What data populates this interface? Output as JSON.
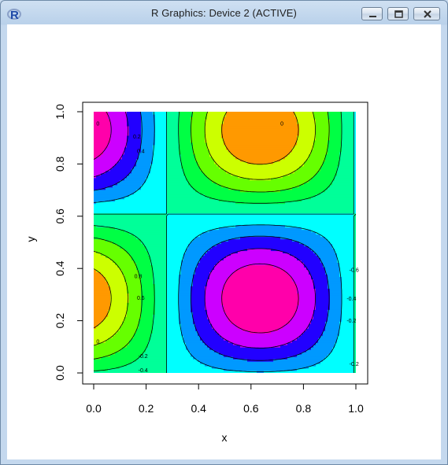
{
  "window": {
    "title": "R Graphics: Device 2 (ACTIVE)",
    "app_icon_letter": "R",
    "buttons": [
      "minimize",
      "maximize",
      "close"
    ]
  },
  "chart_data": {
    "type": "contour",
    "title": "",
    "xlabel": "x",
    "ylabel": "y",
    "xlim": [
      0,
      1
    ],
    "ylim": [
      0,
      1
    ],
    "x_ticks": [
      "0.0",
      "0.2",
      "0.4",
      "0.6",
      "0.8",
      "1.0"
    ],
    "y_ticks": [
      "0.0",
      "0.2",
      "0.4",
      "0.6",
      "0.8",
      "1.0"
    ],
    "contour_levels": [
      -0.8,
      -0.6,
      -0.4,
      -0.2,
      0,
      0.2,
      0.4,
      0.6,
      0.8
    ],
    "contour_labels": [
      {
        "text": "0",
        "x": 0.01,
        "y": 0.955
      },
      {
        "text": "0.2",
        "x": 0.15,
        "y": 0.905
      },
      {
        "text": "0.4",
        "x": 0.165,
        "y": 0.85
      },
      {
        "text": "0.8",
        "x": 0.155,
        "y": 0.37
      },
      {
        "text": "0.6",
        "x": 0.165,
        "y": 0.287
      },
      {
        "text": "0",
        "x": 0.712,
        "y": 0.955
      },
      {
        "text": "-0.6",
        "x": 0.975,
        "y": 0.395
      },
      {
        "text": "-0.4",
        "x": 0.965,
        "y": 0.285
      },
      {
        "text": "-0.2",
        "x": 0.965,
        "y": 0.2
      },
      {
        "text": "0",
        "x": 0.01,
        "y": 0.12
      },
      {
        "text": "-0.2",
        "x": 0.17,
        "y": 0.065
      },
      {
        "text": "-0.4",
        "x": 0.17,
        "y": 0.01
      },
      {
        "text": "-0.2",
        "x": 0.975,
        "y": 0.035
      }
    ],
    "grid": false,
    "colors": {
      "fill_lowest": "#0055ff",
      "fill_low": "#33ff00",
      "fill_mid": "#00ffdd",
      "fill_high": "#8800ff",
      "fill_highest": "#ff0055"
    }
  }
}
